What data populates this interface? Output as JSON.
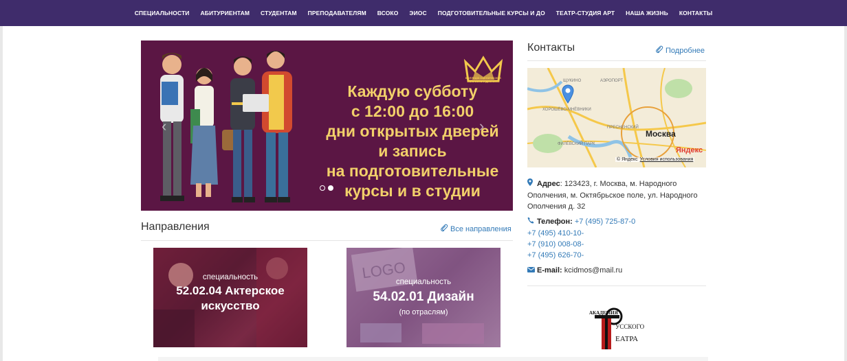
{
  "nav": {
    "items": [
      {
        "label": "СПЕЦИАЛЬНОСТИ"
      },
      {
        "label": "АБИТУРИЕНТАМ"
      },
      {
        "label": "СТУДЕНТАМ"
      },
      {
        "label": "ПРЕПОДАВАТЕЛЯМ"
      },
      {
        "label": "ВСОКО"
      },
      {
        "label": "ЭИОС"
      },
      {
        "label": "ПОДГОТОВИТЕЛЬНЫЕ КУРСЫ И ДО"
      },
      {
        "label": "ТЕАТР-СТУДИЯ АРТ"
      },
      {
        "label": "НАША ЖИЗНЬ"
      },
      {
        "label": "КОНТАКТЫ"
      }
    ]
  },
  "carousel": {
    "logo_text": "КОЛЛЕДЖ СЦЕНИЧЕСКИХ ИСКУССТВ И ДИЗАЙНА",
    "lines": [
      "Каждую субботу",
      "с 12:00 до 16:00",
      "дни открытых дверей",
      "и запись",
      "на подготовительные",
      "курсы и в студии"
    ],
    "arrow_prev": "‹",
    "arrow_next": "›",
    "active_slide": 2,
    "slide_count": 2
  },
  "directions": {
    "title": "Направления",
    "all_link": "Все направления",
    "cards": [
      {
        "small": "специальность",
        "big": "52.02.04  Актерское искусство",
        "sub": ""
      },
      {
        "small": "специальность",
        "big": "54.02.01 Дизайн",
        "sub": "(по отраслям)",
        "image_text": "LOGO"
      }
    ]
  },
  "contacts": {
    "title": "Контакты",
    "more_link": "Подробнее",
    "map": {
      "city": "Москва",
      "brand": "Яндекс",
      "copyright": "© Яндекс",
      "terms": "Условия использования",
      "labels": [
        "ЩУКИНО",
        "АЭРОПОРТ",
        "ХОРОШЁВО-МНЁВНИКИ",
        "ПРЕСНЕНСКИЙ",
        "ФИЛЁВСКИЙ ПАРК"
      ]
    },
    "address_label": "Адрес",
    "address": ": 123423, г. Москва, м. Народного Ополчения, м. Октябрьское поле, ул. Народного Ополчения д. 32",
    "phone_label": "Телефон:",
    "phones": [
      "+7 (495) 725-87-0",
      "+7 (495) 410-10-",
      "+7 (910) 008-08-",
      "+7 (495) 626-70-"
    ],
    "email_label": "E-mail:",
    "email": "kcidmos@mail.ru"
  },
  "partner": {
    "line1": "АКАДЕМИЯ",
    "line2": "УССКОГО",
    "line3": "ЕАТРА"
  },
  "colors": {
    "nav_bg": "#3f2c6b",
    "link": "#337ab7",
    "slide_bg": "#5b1644",
    "slide_text": "#f2d06a"
  }
}
